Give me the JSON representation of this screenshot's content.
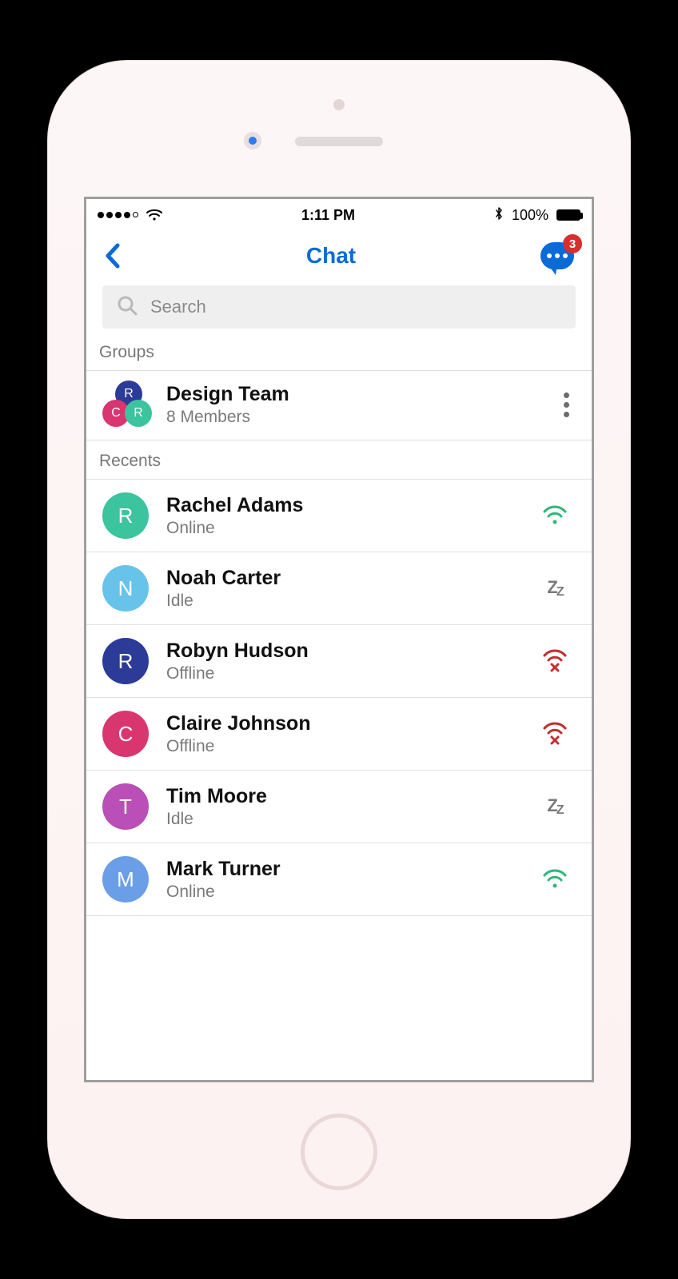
{
  "status_bar": {
    "time": "1:11 PM",
    "battery_pct": "100%"
  },
  "header": {
    "title": "Chat",
    "badge_count": "3"
  },
  "search": {
    "placeholder": "Search"
  },
  "sections": {
    "groups_label": "Groups",
    "recents_label": "Recents"
  },
  "group": {
    "name": "Design Team",
    "meta": "8 Members",
    "avatars": [
      "R",
      "C",
      "R"
    ]
  },
  "contacts": [
    {
      "initial": "R",
      "name": "Rachel Adams",
      "status": "Online",
      "color": "#3bc49d",
      "state": "online"
    },
    {
      "initial": "N",
      "name": "Noah Carter",
      "status": "Idle",
      "color": "#67c3ea",
      "state": "idle"
    },
    {
      "initial": "R",
      "name": "Robyn Hudson",
      "status": "Offline",
      "color": "#2b3b97",
      "state": "offline"
    },
    {
      "initial": "C",
      "name": "Claire Johnson",
      "status": "Offline",
      "color": "#d93670",
      "state": "offline"
    },
    {
      "initial": "T",
      "name": "Tim Moore",
      "status": "Idle",
      "color": "#b94fb7",
      "state": "idle"
    },
    {
      "initial": "M",
      "name": "Mark Turner",
      "status": "Online",
      "color": "#6a9fe8",
      "state": "online"
    }
  ]
}
